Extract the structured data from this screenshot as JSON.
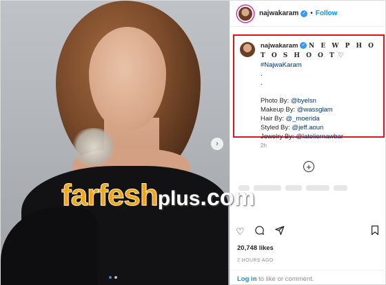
{
  "post": {
    "username": "najwakaram",
    "follow_label": "Follow",
    "separator": "•",
    "caption": {
      "headline": "N E W P H O T O S H O O T",
      "heart": "♡",
      "hashtag": "#NajwaKaram",
      "dot1": ".",
      "dot2": ".",
      "credits": [
        {
          "label": "Photo By: ",
          "handle": "@byelsn"
        },
        {
          "label": "Makeup By: ",
          "handle": "@wassglam"
        },
        {
          "label": "Hair By: ",
          "handle": "@_moerida"
        },
        {
          "label": "Styled By: ",
          "handle": "@jeff.aoun"
        },
        {
          "label": "Jewelry By: ",
          "handle": "@lateliernawbar"
        }
      ]
    },
    "caption_time": "2h",
    "likes": "20,748 likes",
    "posted_ago": "2 HOURS AGO",
    "login_link": "Log in",
    "login_suffix": " to like or comment."
  },
  "watermark": {
    "main": "farfesh",
    "plus": "plus",
    "com": ".com"
  },
  "icons": {
    "next": "chevron-right-icon",
    "add": "plus-circle-icon",
    "like": "heart-icon",
    "comment": "comment-icon",
    "share": "share-icon",
    "save": "bookmark-icon"
  },
  "colors": {
    "accent": "#0095f6",
    "highlight_border": "#e3121a",
    "watermark": "#f0a51d"
  }
}
